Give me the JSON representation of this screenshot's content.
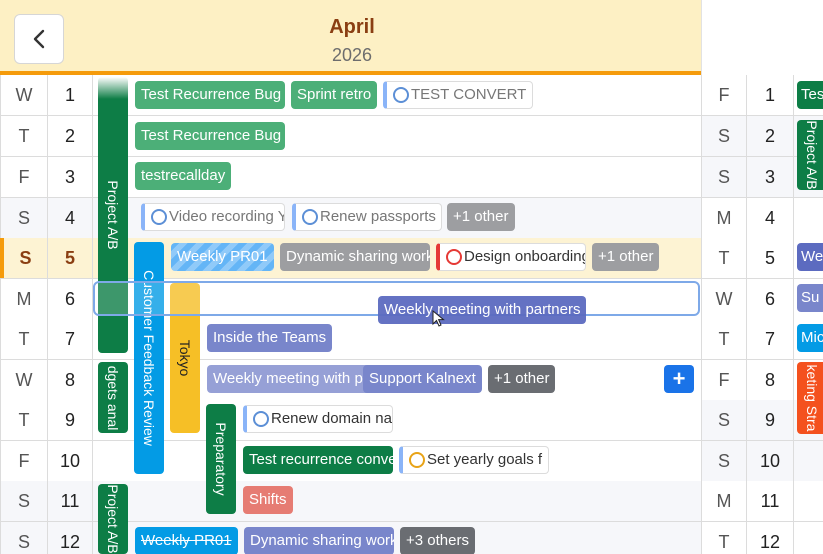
{
  "header": {
    "month": "April",
    "year": "2026",
    "back_icon": "chevron-left-icon"
  },
  "days": [
    {
      "dow": "W",
      "num": "1"
    },
    {
      "dow": "T",
      "num": "2"
    },
    {
      "dow": "F",
      "num": "3"
    },
    {
      "dow": "S",
      "num": "4"
    },
    {
      "dow": "S",
      "num": "5"
    },
    {
      "dow": "M",
      "num": "6"
    },
    {
      "dow": "T",
      "num": "7"
    },
    {
      "dow": "W",
      "num": "8"
    },
    {
      "dow": "T",
      "num": "9"
    },
    {
      "dow": "F",
      "num": "10"
    },
    {
      "dow": "S",
      "num": "11"
    },
    {
      "dow": "S",
      "num": "12"
    }
  ],
  "next_days": [
    {
      "dow": "F",
      "num": "1"
    },
    {
      "dow": "S",
      "num": "2"
    },
    {
      "dow": "S",
      "num": "3"
    },
    {
      "dow": "M",
      "num": "4"
    },
    {
      "dow": "T",
      "num": "5"
    },
    {
      "dow": "W",
      "num": "6"
    },
    {
      "dow": "T",
      "num": "7"
    },
    {
      "dow": "F",
      "num": "8"
    },
    {
      "dow": "S",
      "num": "9"
    },
    {
      "dow": "S",
      "num": "10"
    },
    {
      "dow": "M",
      "num": "11"
    },
    {
      "dow": "T",
      "num": "12"
    }
  ],
  "events": {
    "r1_a": "Test Recurrence Bug",
    "r1_b": "Sprint retro",
    "r1_task": "TEST CONVERT",
    "r2_a": "Test Recurrence Bug",
    "r3_a": "testrecallday",
    "r4_task1": "Video recording Y",
    "r4_task2": "Renew passports",
    "r4_more": "+1 other",
    "r5_a": "Weekly PR01",
    "r5_b": "Dynamic sharing work",
    "r5_task": "Design onboarding",
    "r5_more": "+1 other",
    "r7_a": "Inside the Teams",
    "r8_a": "Weekly meeting with p",
    "r8_b": "Support Kalnext",
    "r8_more": "+1 other",
    "r9_task": "Renew domain na",
    "r10_a": "Test recurrence conve",
    "r10_task": "Set yearly goals f",
    "r11_a": "Shifts",
    "r12_a": "Weekly PR01",
    "r12_b": "Dynamic sharing work",
    "r12_more": "+3 others",
    "drag": "Weekly meeting with partners",
    "add": "+"
  },
  "bars": {
    "project1": "Project A/B",
    "budgets": "dgets anal",
    "project2": "Project A/B",
    "feedback": "Customer Feedback Review",
    "tokyo": "Tokyo",
    "prep": "Preparatory"
  },
  "next_events": {
    "n1": "Tes",
    "n2": "Project A/B",
    "n5": "We",
    "n6": "Su",
    "n7": "Mic",
    "n8": "keting Stra"
  },
  "colors": {
    "header_bg": "#fdf0c4",
    "accent": "#f59b0b",
    "month": "#8a3e12"
  }
}
